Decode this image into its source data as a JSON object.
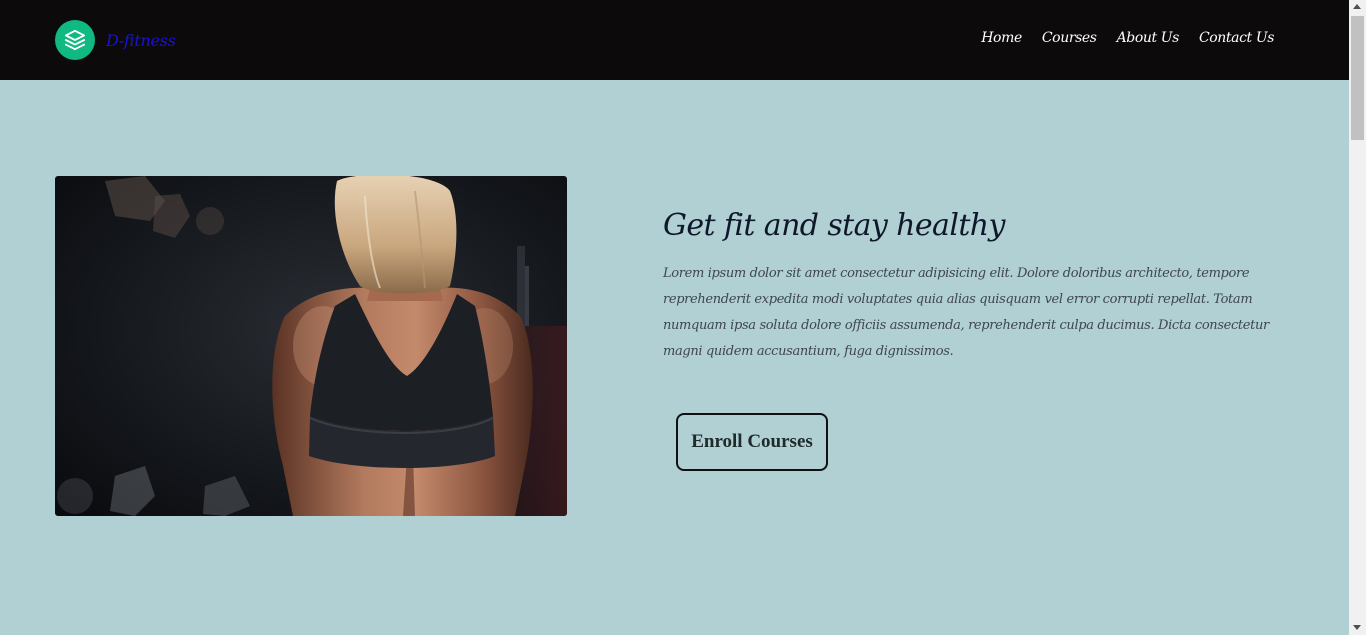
{
  "brand": {
    "name": "D-fitness",
    "logo_icon": "layers-icon",
    "logo_bg": "#10b981",
    "name_color": "#1a12d6"
  },
  "nav": {
    "links": [
      {
        "label": "Home"
      },
      {
        "label": "Courses"
      },
      {
        "label": "About Us"
      },
      {
        "label": "Contact Us"
      }
    ]
  },
  "hero": {
    "image_subject": "fitness-woman-back-photo",
    "title": "Get fit and stay healthy",
    "body": "Lorem ipsum dolor sit amet consectetur adipisicing elit. Dolore doloribus architecto, tempore reprehenderit expedita modi voluptates quia alias quisquam vel error corrupti repellat. Totam numquam ipsa soluta dolore officiis assumenda, reprehenderit culpa ducimus. Dicta consectetur magni quidem accusantium, fuga dignissimos.",
    "cta_label": "Enroll Courses"
  },
  "colors": {
    "page_bg": "#b0d0d3",
    "navbar_bg": "#0c0a0b"
  }
}
